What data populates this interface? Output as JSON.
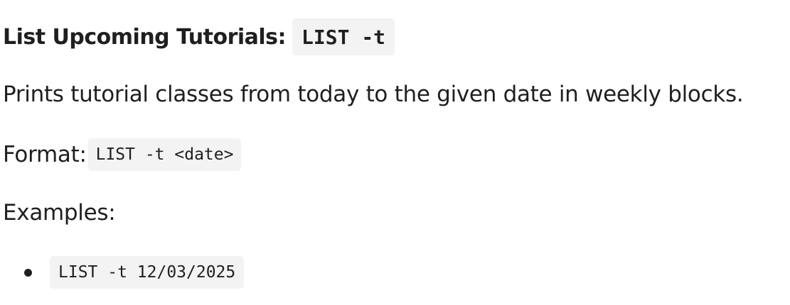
{
  "section": {
    "heading_label": "List Upcoming Tutorials:",
    "heading_command": "LIST -t",
    "description": "Prints tutorial classes from today to the given date in weekly blocks.",
    "format_label": "Format:",
    "format_command": "LIST -t <date>",
    "examples_label": "Examples:",
    "examples": [
      {
        "command": "LIST -t 12/03/2025"
      }
    ]
  }
}
